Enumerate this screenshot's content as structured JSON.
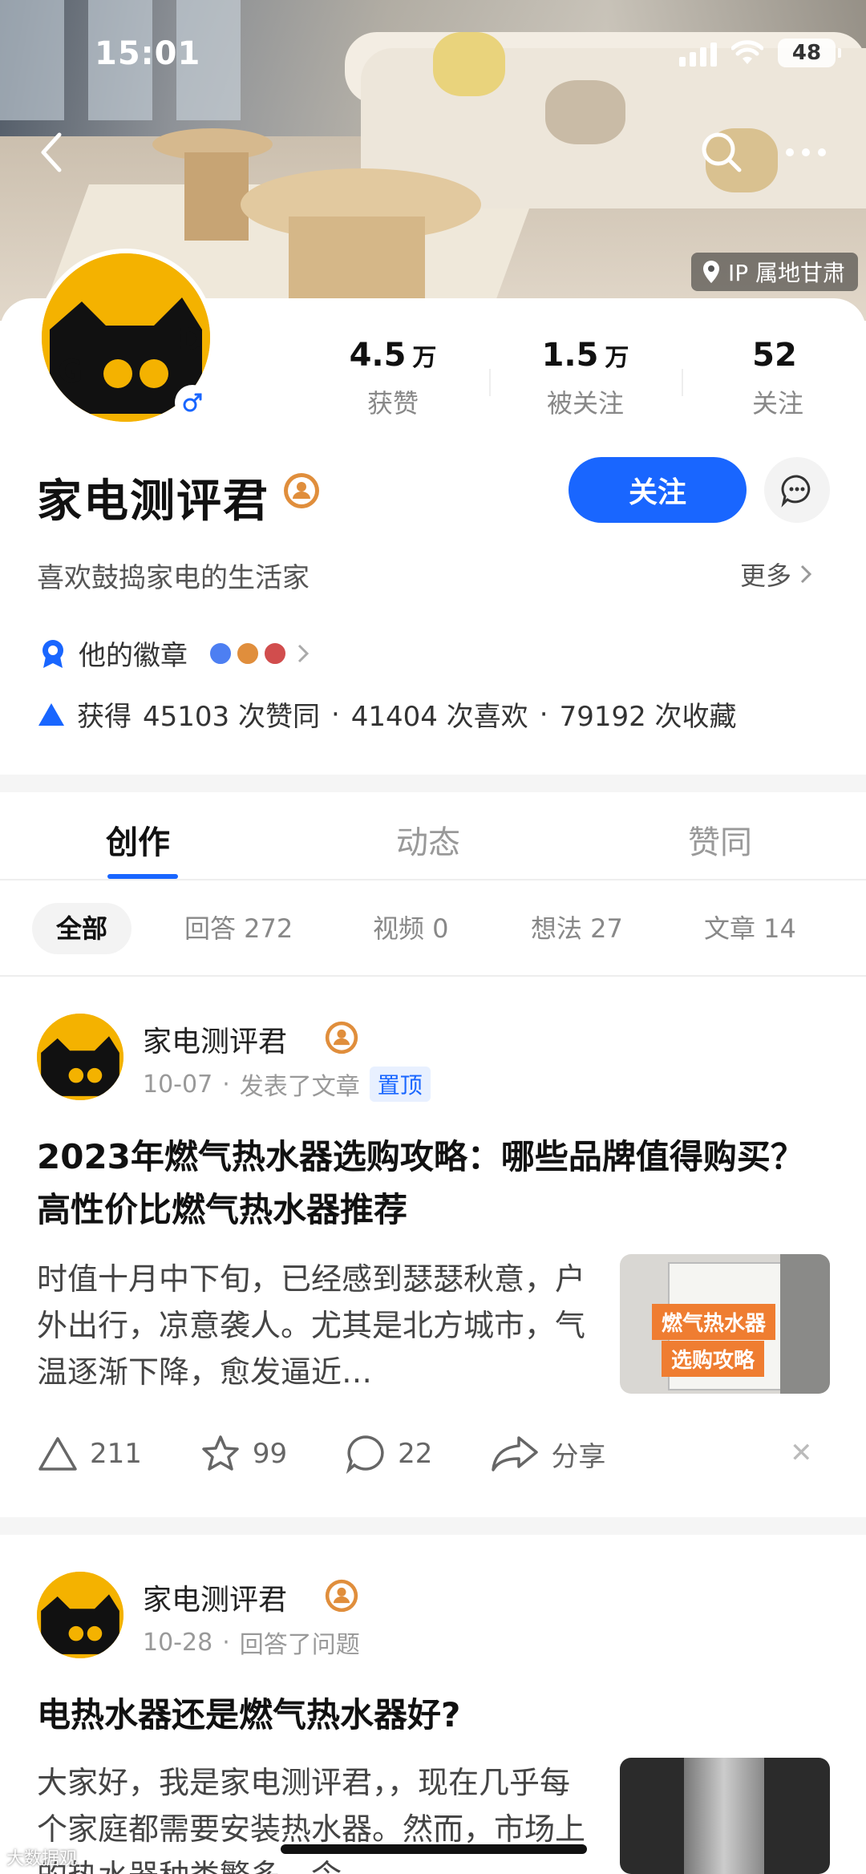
{
  "status_bar": {
    "time": "15:01",
    "battery": "48"
  },
  "header": {
    "ip_location": "IP 属地甘肃"
  },
  "profile": {
    "name": "家电测评君",
    "bio": "喜欢鼓捣家电的生活家",
    "more_label": "更多",
    "follow_label": "关注",
    "stats": [
      {
        "value": "4.5",
        "unit": "万",
        "label": "获赞"
      },
      {
        "value": "1.5",
        "unit": "万",
        "label": "被关注"
      },
      {
        "value": "52",
        "unit": "",
        "label": "关注"
      }
    ],
    "badges_label": "他的徽章",
    "achievements": {
      "prefix": "获得",
      "likes": "45103 次赞同",
      "favorites": "41404 次喜欢",
      "collections": "79192 次收藏",
      "sep": "·"
    }
  },
  "tabs": [
    "创作",
    "动态",
    "赞同"
  ],
  "filters": [
    "全部",
    "回答 272",
    "视频 0",
    "想法 27",
    "文章 14"
  ],
  "posts": [
    {
      "author": "家电测评君",
      "date": "10-07",
      "action": "发表了文章",
      "pinned": "置顶",
      "title": "2023年燃气热水器选购攻略：哪些品牌值得购买？高性价比燃气热水器推荐",
      "excerpt": "时值十月中下旬，已经感到瑟瑟秋意，户外出行，凉意袭人。尤其是北方城市，气温逐渐下降，愈发逼近…",
      "thumb_text_1": "燃气热水器",
      "thumb_text_2": "选购攻略",
      "likes": "211",
      "favorites": "99",
      "comments": "22",
      "share": "分享"
    },
    {
      "author": "家电测评君",
      "date": "10-28",
      "action": "回答了问题",
      "title": "电热水器还是燃气热水器好?",
      "excerpt": "大家好，我是家电测评君，，现在几乎每个家庭都需要安装热水器。然而，市场上的热水器种类繁多，令"
    }
  ],
  "watermark": "大数据观",
  "colors": {
    "accent": "#1966ff",
    "avatar_bg": "#f4b200"
  }
}
